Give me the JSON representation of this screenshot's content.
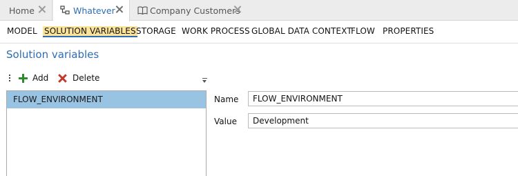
{
  "tabs": [
    {
      "label": "Home",
      "icon": "none",
      "active": false
    },
    {
      "label": "Whatever",
      "icon": "diagram-icon",
      "active": true
    },
    {
      "label": "Company Customers",
      "icon": "book-icon",
      "active": false
    }
  ],
  "subnav": {
    "items": [
      "MODEL",
      "SOLUTION VARIABLES",
      "STORAGE",
      "WORK PROCESS",
      "GLOBAL DATA CONTEXT",
      "FLOW",
      "PROPERTIES"
    ],
    "active": "SOLUTION VARIABLES"
  },
  "section": {
    "title": "Solution variables"
  },
  "toolbar": {
    "add_label": "Add",
    "delete_label": "Delete"
  },
  "variables": [
    {
      "name": "FLOW_ENVIRONMENT",
      "selected": true
    }
  ],
  "form": {
    "name_label": "Name",
    "name_value": "FLOW_ENVIRONMENT",
    "value_label": "Value",
    "value_value": "Development"
  },
  "colors": {
    "accent": "#2d6cb5",
    "active_nav_highlight": "#fbe49a",
    "selection": "#99c3e2",
    "add_icon": "#2d8a2d",
    "delete_icon": "#c0392b"
  }
}
